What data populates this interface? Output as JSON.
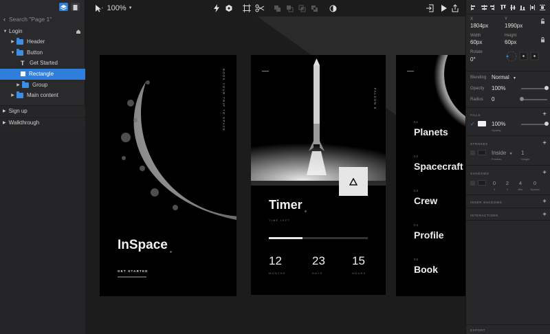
{
  "toolbar": {
    "zoom": "100%"
  },
  "sidebar": {
    "search_placeholder": "Search \"Page 1\"",
    "layers": [
      {
        "label": "Login"
      },
      {
        "label": "Header"
      },
      {
        "label": "Button"
      },
      {
        "label": "Get Started"
      },
      {
        "label": "Rectangle"
      },
      {
        "label": "Group"
      },
      {
        "label": "Main content"
      }
    ],
    "sections": [
      {
        "label": "Sign up"
      },
      {
        "label": "Walkthrough"
      }
    ]
  },
  "canvas": {
    "login": {
      "vertical_text": "BOOK YOUR TRIP TO SPACE",
      "title": "InSpace",
      "cta": "GET STARTED"
    },
    "timer": {
      "vertical_text": "FALCON 9",
      "title": "Timer",
      "subtitle": "TIME LEFT",
      "progress": 0.34,
      "stats": [
        {
          "value": "12",
          "label": "MONTHS"
        },
        {
          "value": "23",
          "label": "DAYS"
        },
        {
          "value": "15",
          "label": "HOURS"
        }
      ]
    },
    "menu": {
      "items": [
        {
          "num": "01",
          "label": "Planets"
        },
        {
          "num": "02",
          "label": "Spacecraft"
        },
        {
          "num": "03",
          "label": "Crew"
        },
        {
          "num": "04",
          "label": "Profile"
        },
        {
          "num": "05",
          "label": "Book"
        }
      ]
    }
  },
  "inspector": {
    "x_label": "X",
    "x_value": "1804px",
    "y_label": "Y",
    "y_value": "1990px",
    "width_label": "Width",
    "width_value": "60px",
    "height_label": "Height",
    "height_value": "60px",
    "rotate_label": "Rotate",
    "rotate_value": "0°",
    "blending_label": "Blending",
    "blending_value": "Normal",
    "opacity_label": "Opacity",
    "opacity_value": "100%",
    "opacity_level": 1.0,
    "radius_label": "Radius",
    "radius_value": "0",
    "fills_title": "FILLS",
    "fill_opacity": "100%",
    "fill_opacity_label": "Opacity",
    "strokes_title": "STROKES",
    "stroke_position": "Inside",
    "stroke_position_label": "Position",
    "stroke_weight": "1",
    "stroke_weight_label": "Weight",
    "shadows_title": "SHADOWS",
    "shadow_values": [
      {
        "value": "0",
        "label": "X"
      },
      {
        "value": "2",
        "label": "Y"
      },
      {
        "value": "4",
        "label": "Blur"
      },
      {
        "value": "0",
        "label": "Spread"
      }
    ],
    "inner_shadows_title": "INNER SHADOWS",
    "interactions_title": "INTERACTIONS",
    "export_title": "EXPORT"
  },
  "colors": {
    "accent": "#2e7fdc",
    "folder": "#3c8de6",
    "panel": "#28282a",
    "canvas": "#1c1c1d"
  }
}
